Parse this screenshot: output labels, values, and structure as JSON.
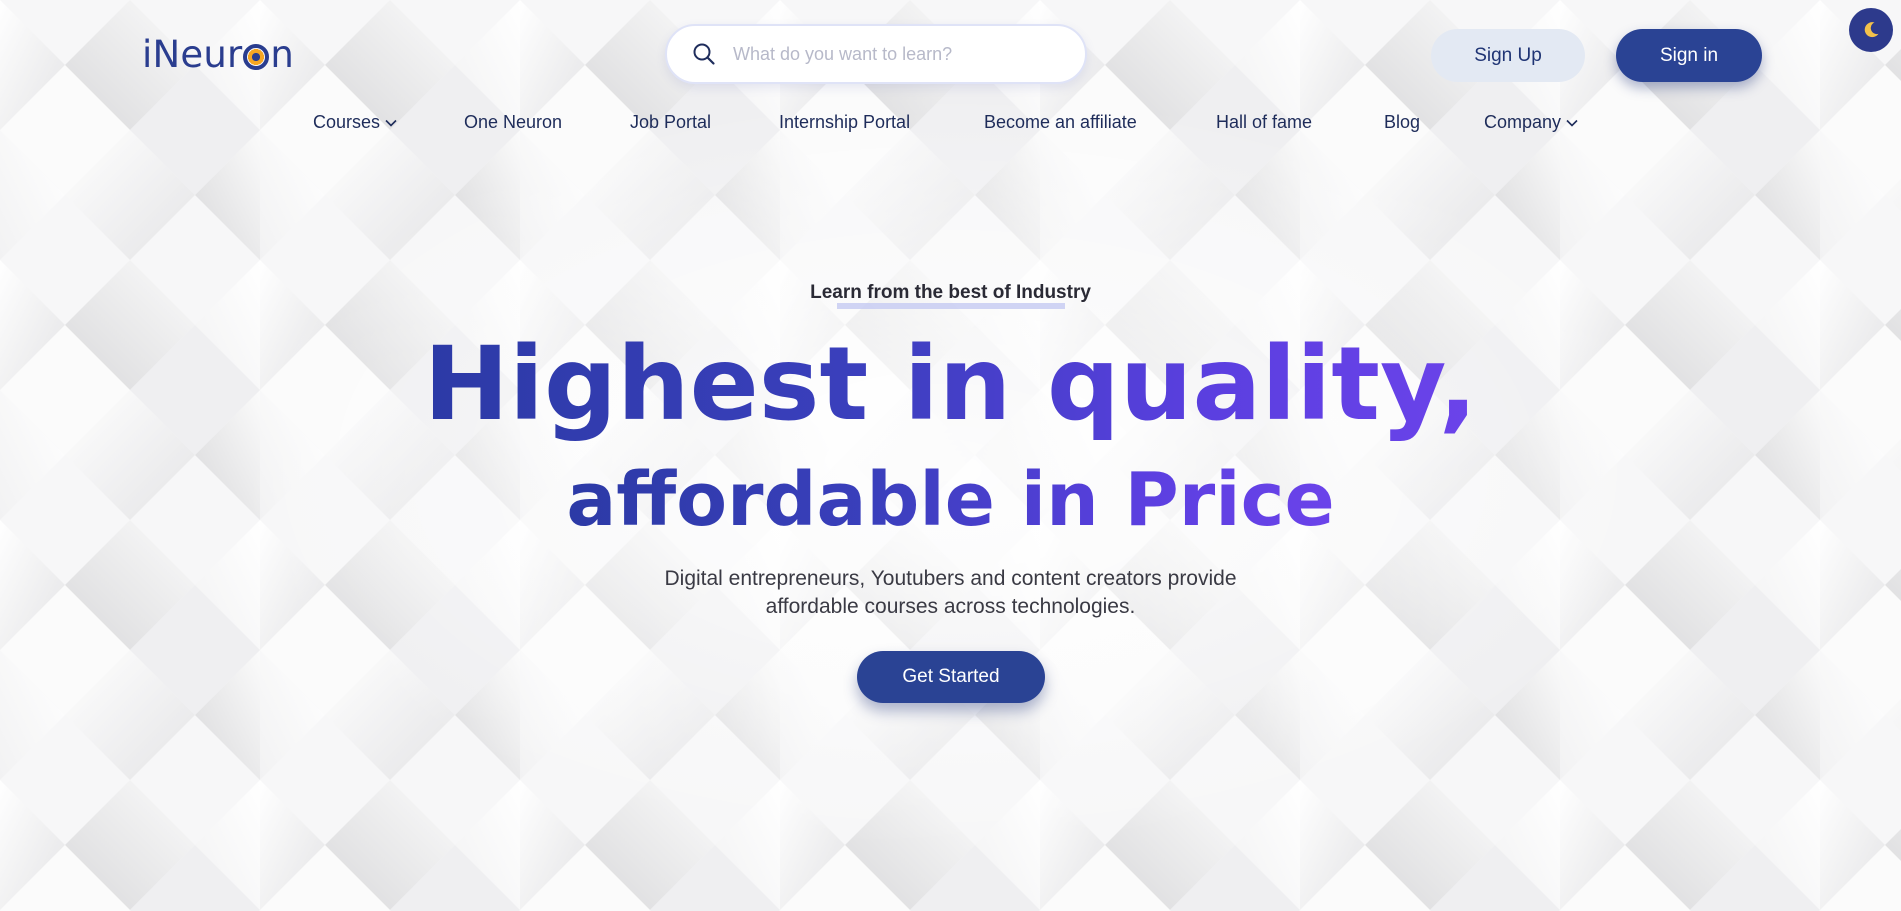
{
  "header": {
    "logo_text_before": "iNeur",
    "logo_text_after": "n",
    "search": {
      "placeholder": "What do you want to learn?"
    },
    "sign_up_label": "Sign Up",
    "sign_in_label": "Sign in",
    "theme_toggle_icon": "moon-icon"
  },
  "nav": {
    "items": [
      {
        "label": "Courses",
        "has_dropdown": true
      },
      {
        "label": "One Neuron",
        "has_dropdown": false
      },
      {
        "label": "Job Portal",
        "has_dropdown": false
      },
      {
        "label": "Internship Portal",
        "has_dropdown": false
      },
      {
        "label": "Become an affiliate",
        "has_dropdown": false
      },
      {
        "label": "Hall of fame",
        "has_dropdown": false
      },
      {
        "label": "Blog",
        "has_dropdown": false
      },
      {
        "label": "Company",
        "has_dropdown": true
      }
    ]
  },
  "hero": {
    "eyebrow": "Learn from the best of Industry",
    "headline_line1": "Highest in quality,",
    "headline_line2": "affordable in Price",
    "subtitle_line1": "Digital entrepreneurs, Youtubers and content creators provide",
    "subtitle_line2": "affordable courses across technologies.",
    "cta_label": "Get Started"
  },
  "colors": {
    "brand": "#2a4394",
    "headline_gradient_start": "#2c3aa6",
    "headline_gradient_end": "#6b43ea",
    "background": "#f6f6f7"
  }
}
